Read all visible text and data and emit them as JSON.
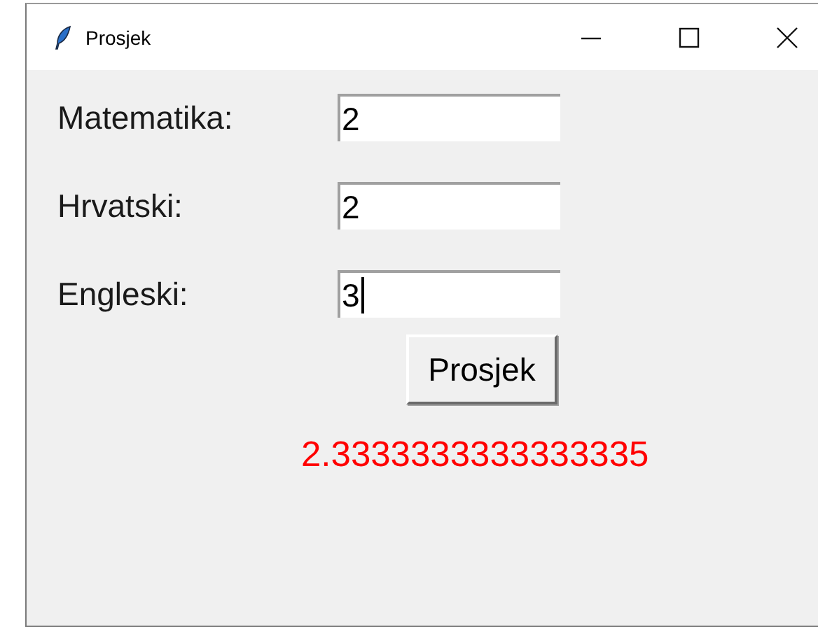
{
  "window": {
    "title": "Prosjek"
  },
  "fields": [
    {
      "label": "Matematika:",
      "value": "2",
      "focused": false
    },
    {
      "label": "Hrvatski:",
      "value": "2",
      "focused": false
    },
    {
      "label": "Engleski:",
      "value": "3",
      "focused": true
    }
  ],
  "button": {
    "label": "Prosjek"
  },
  "result": {
    "text": "2.3333333333333335",
    "color": "#ff0000"
  }
}
